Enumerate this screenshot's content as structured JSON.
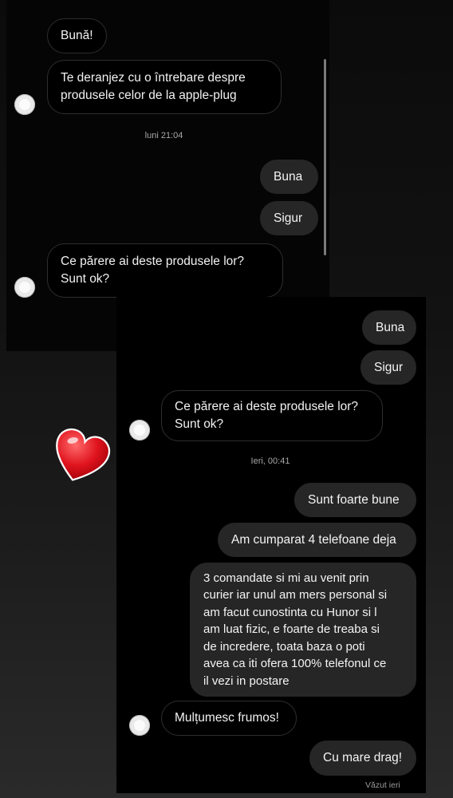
{
  "screenshot1": {
    "messages": [
      {
        "text": "Bună!"
      },
      {
        "text": "Te deranjez cu o întrebare despre\nprodusele celor de la apple-plug"
      },
      {
        "text": "Buna"
      },
      {
        "text": "Sigur"
      },
      {
        "text": "Ce părere ai deste  produsele lor?\nSunt ok?"
      }
    ],
    "timestamp": "luni 21:04"
  },
  "screenshot2": {
    "messages": [
      {
        "text": "Buna"
      },
      {
        "text": "Sigur"
      },
      {
        "text": "Ce părere ai deste  produsele lor?\nSunt ok?"
      },
      {
        "text": "Sunt foarte bune"
      },
      {
        "text": "Am cumparat 4 telefoane deja"
      },
      {
        "text": "3 comandate si mi au venit prin\ncurier iar unul am mers personal si\nam facut cunostinta cu Hunor si l\nam luat fizic, e foarte de treaba si\nde incredere, toata baza o poti\navea ca iti ofera 100% telefonul ce\nil vezi in postare"
      },
      {
        "text": "Mulțumesc frumos!"
      },
      {
        "text": "Cu mare drag!"
      }
    ],
    "timestamp": "Ieri, 00:41",
    "seen": "Văzut ieri"
  },
  "colors": {
    "incoming_bubble": "#000000",
    "outgoing_bubble": "#262626",
    "heart": "#e0141e"
  },
  "icons": [
    "avatar-icon",
    "heart-sticker-icon"
  ]
}
